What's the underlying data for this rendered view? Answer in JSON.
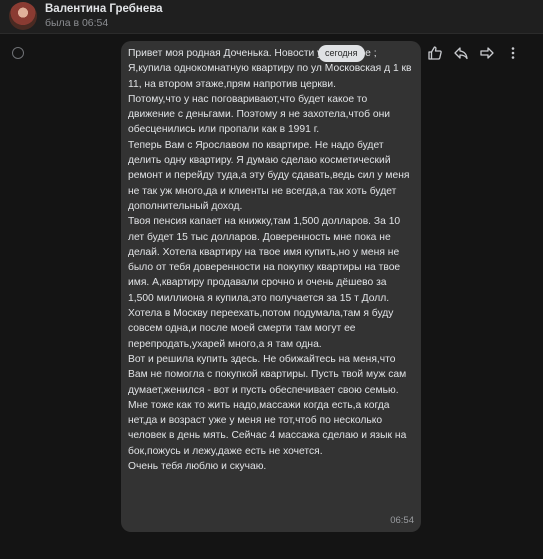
{
  "header": {
    "contact_name": "Валентина Гребнева",
    "last_seen": "была в 06:54"
  },
  "date_divider": "сегодня",
  "message": {
    "text": "Привет моя родная Доченька. Новости у нас такие ;\nЯ,купила однокомнатную квартиру по ул Московская д 1 кв 11, на втором этаже,прям напротив церкви.\nПотому,что у нас поговаривают,что будет какое то движение с деньгами. Поэтому я не захотела,чтоб они обесценились или пропали как в 1991 г.\nТеперь Вам с Ярославом по квартире. Не надо будет делить одну квартиру. Я думаю сделаю косметический ремонт и перейду туда,а эту буду сдавать,ведь сил у меня не так уж много,да и клиенты не всегда,а так хоть будет дополнительный доход.\nТвоя пенсия капает на книжку,там 1,500 долларов. За 10 лет будет 15 тыс долларов. Доверенность мне пока не делай. Хотела квартиру на твое имя купить,но у меня не было от тебя доверенности на покупку квартиры на твое имя. А,квартиру продавали срочно и очень дёшево за 1,500 миллиона я купила,это получается за 15 т Долл.\nХотела в Москву переехать,потом подумала,там я буду совсем одна,и после моей смерти там могут ее перепродать,ухарей много,а я там одна.\nВот и решила купить здесь. Не обижайтесь на меня,что Вам не помогла с покупкой квартиры. Пусть твой муж сам думает,женился - вот и пусть обеспечивает свою семью. Мне тоже как то жить надо,массажи когда есть,а когда нет,да и возраст уже у меня не тот,чтоб по несколько человек в день мять. Сейчас 4 массажа сделаю и язык на бок,пожусь и лежу,даже есть не хочется.\nОчень тебя люблю и скучаю.",
    "time": "06:54"
  },
  "actions": [
    {
      "icon": "thumbs-up-icon"
    },
    {
      "icon": "reply-icon"
    },
    {
      "icon": "forward-icon"
    },
    {
      "icon": "more-icon"
    }
  ],
  "colors": {
    "background": "#141414",
    "header": "#1f1f1f",
    "bubble": "#333333",
    "text": "#e1e3e6",
    "muted": "#8c8e92"
  }
}
